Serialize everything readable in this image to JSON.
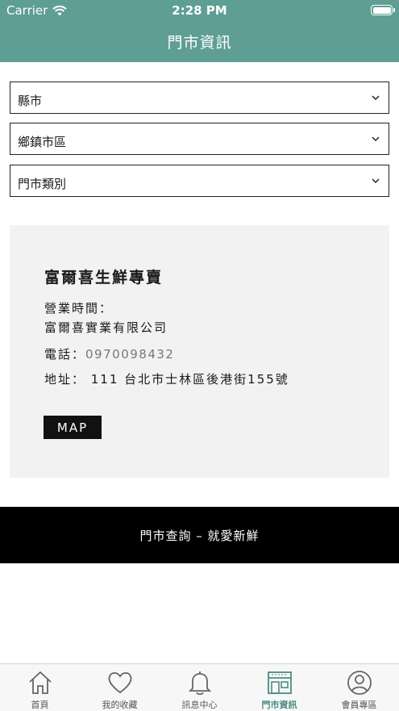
{
  "status_bar": {
    "carrier": "Carrier",
    "time": "2:28 PM"
  },
  "header": {
    "title": "門市資訊"
  },
  "filters": {
    "county": "縣市",
    "township": "鄉鎮市區",
    "category": "門市類別"
  },
  "store": {
    "name": "富爾喜生鮮專賣",
    "hours_label": "營業時間：",
    "company": "富爾喜實業有限公司",
    "phone_label": "電話：",
    "phone": "0970098432",
    "address": "地址： 111 台北市士林區後港街155號",
    "map_button": "MAP"
  },
  "banner": {
    "text": "門市查詢 – 就愛新鮮"
  },
  "tabbar": {
    "items": [
      {
        "label": "首頁",
        "icon": "home-icon"
      },
      {
        "label": "我的收藏",
        "icon": "heart-icon"
      },
      {
        "label": "訊息中心",
        "icon": "bell-icon"
      },
      {
        "label": "門市資訊",
        "icon": "store-icon"
      },
      {
        "label": "會員專區",
        "icon": "user-icon"
      }
    ],
    "active_index": 3
  },
  "colors": {
    "accent": "#5e9e94",
    "active_tab": "#4d8c82"
  }
}
